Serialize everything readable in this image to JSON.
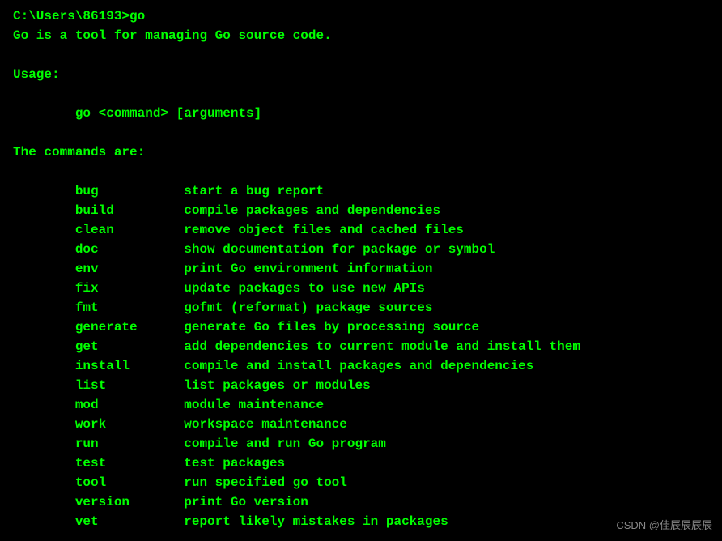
{
  "prompt": "C:\\Users\\86193>",
  "command": "go",
  "intro": "Go is a tool for managing Go source code.",
  "usage_label": "Usage:",
  "usage_line": "go <command> [arguments]",
  "commands_label": "The commands are:",
  "commands": [
    {
      "name": "bug",
      "desc": "start a bug report"
    },
    {
      "name": "build",
      "desc": "compile packages and dependencies"
    },
    {
      "name": "clean",
      "desc": "remove object files and cached files"
    },
    {
      "name": "doc",
      "desc": "show documentation for package or symbol"
    },
    {
      "name": "env",
      "desc": "print Go environment information"
    },
    {
      "name": "fix",
      "desc": "update packages to use new APIs"
    },
    {
      "name": "fmt",
      "desc": "gofmt (reformat) package sources"
    },
    {
      "name": "generate",
      "desc": "generate Go files by processing source"
    },
    {
      "name": "get",
      "desc": "add dependencies to current module and install them"
    },
    {
      "name": "install",
      "desc": "compile and install packages and dependencies"
    },
    {
      "name": "list",
      "desc": "list packages or modules"
    },
    {
      "name": "mod",
      "desc": "module maintenance"
    },
    {
      "name": "work",
      "desc": "workspace maintenance"
    },
    {
      "name": "run",
      "desc": "compile and run Go program"
    },
    {
      "name": "test",
      "desc": "test packages"
    },
    {
      "name": "tool",
      "desc": "run specified go tool"
    },
    {
      "name": "version",
      "desc": "print Go version"
    },
    {
      "name": "vet",
      "desc": "report likely mistakes in packages"
    }
  ],
  "watermark": "CSDN @佳辰辰辰辰"
}
